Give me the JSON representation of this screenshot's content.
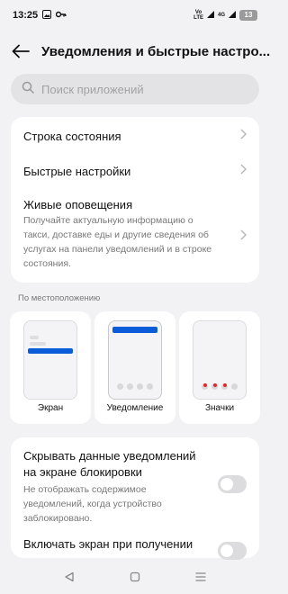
{
  "status_bar": {
    "time": "13:25",
    "network_volte": "Vo\nLTE",
    "network_gen": "4G",
    "battery": "13"
  },
  "header": {
    "title": "Уведомления и быстрые настро..."
  },
  "search": {
    "placeholder": "Поиск приложений"
  },
  "main_card": {
    "status_bar_label": "Строка состояния",
    "quick_settings_label": "Быстрые настройки",
    "live_alerts_label": "Живые оповещения",
    "live_alerts_desc": "Получайте актуальную информацию о такси, доставке еды и другие сведения об услугах на панели уведомлений и в строке состояния."
  },
  "location": {
    "section_label": "По местоположению",
    "tiles": [
      {
        "label": "Экран"
      },
      {
        "label": "Уведомление"
      },
      {
        "label": "Значки"
      }
    ]
  },
  "toggles": [
    {
      "title": "Скрывать данные уведомлений на экране блокировки",
      "desc": "Не отображать содержимое уведомлений, когда устройство заблокировано.",
      "on": false
    },
    {
      "title": "Включать экран при получении",
      "on": false
    }
  ],
  "colors": {
    "accent": "#0b5cd8",
    "badge_red": "#e02a2a",
    "background": "#f2f2f4"
  }
}
